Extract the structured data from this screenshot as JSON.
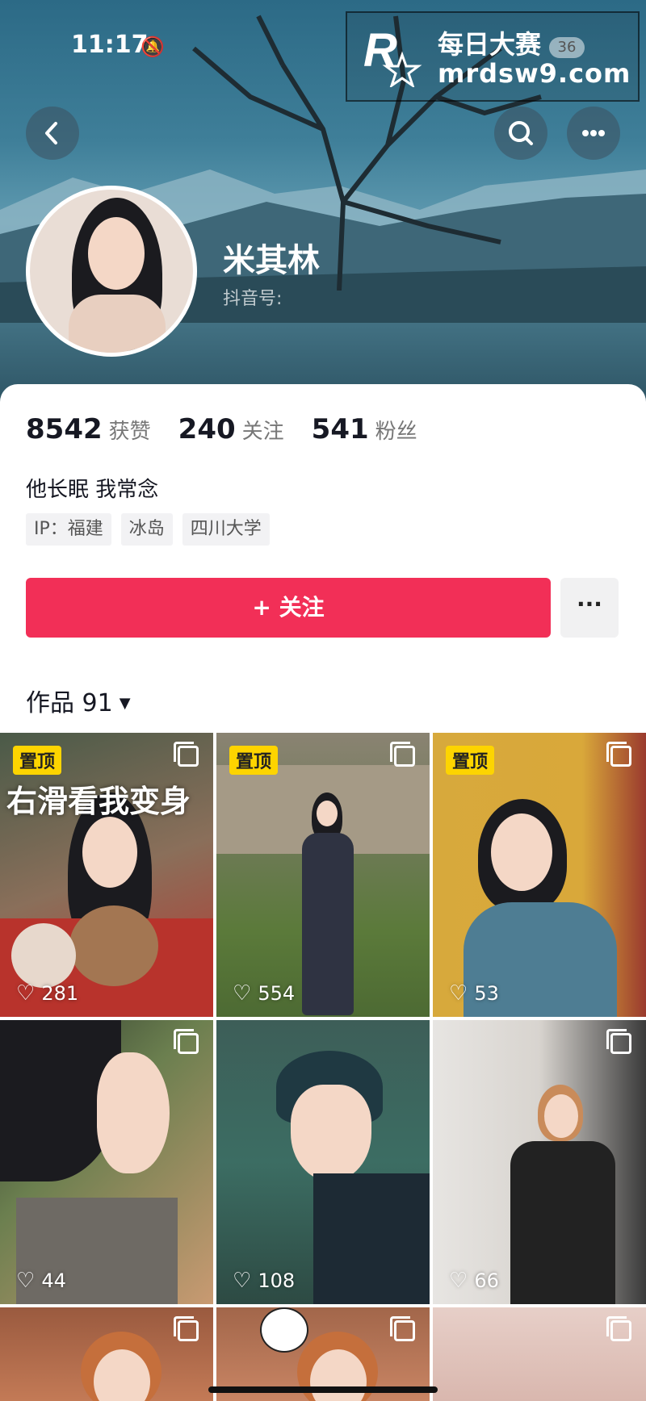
{
  "status_bar": {
    "time": "11:17",
    "bell_icon": "bell-slash-icon"
  },
  "watermark": {
    "title": "每日大赛",
    "url": "mrdsw9.com",
    "badge": "36",
    "logo_letter": "R",
    "logo_small": "每日大赛"
  },
  "header": {
    "back_icon": "chevron-left-icon",
    "search_icon": "search-icon",
    "more_icon": "more-dots-icon"
  },
  "profile": {
    "name": "米其林",
    "douyin_id_label": "抖音号:"
  },
  "stats": [
    {
      "value": "8542",
      "label": "获赞"
    },
    {
      "value": "240",
      "label": "关注"
    },
    {
      "value": "541",
      "label": "粉丝"
    }
  ],
  "bio": "他长眠 我常念",
  "tags": [
    "IP：福建",
    "冰岛",
    "四川大学"
  ],
  "actions": {
    "follow_label": "+ 关注",
    "more_label": "···"
  },
  "works": {
    "label": "作品 91",
    "caret": "▼"
  },
  "videos": [
    {
      "pinned": "置顶",
      "likes": "281",
      "overlay": "右滑看我变身"
    },
    {
      "pinned": "置顶",
      "likes": "554"
    },
    {
      "pinned": "置顶",
      "likes": "53"
    },
    {
      "likes": "44"
    },
    {
      "likes": "108"
    },
    {
      "likes": "66"
    },
    {},
    {},
    {}
  ],
  "colors": {
    "accent": "#f22f57",
    "pin_badge": "#fdd400"
  }
}
